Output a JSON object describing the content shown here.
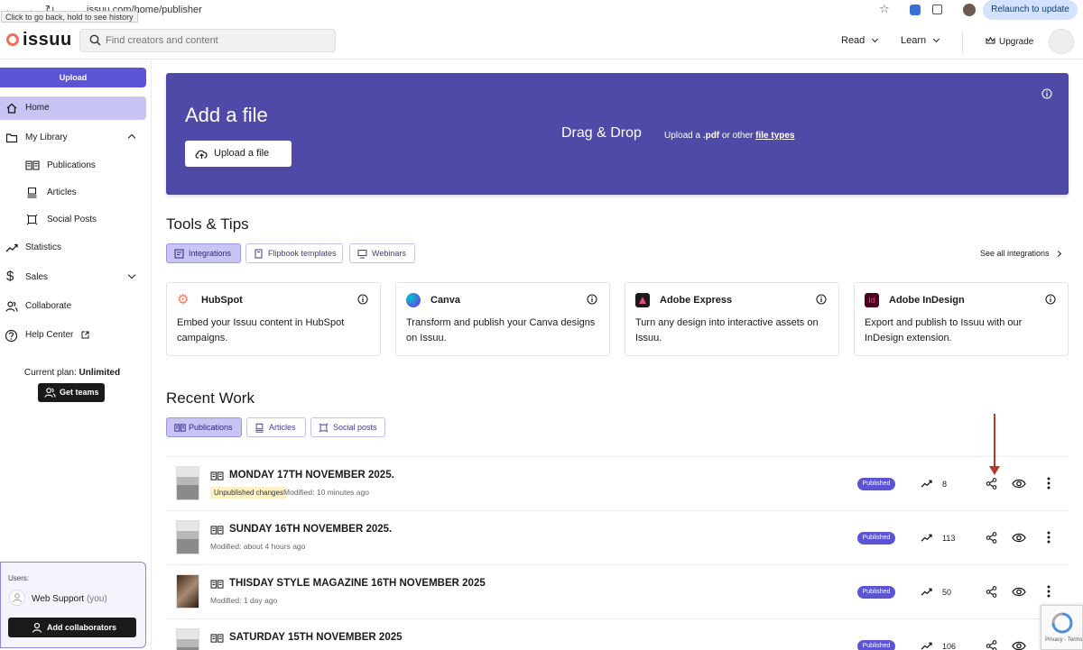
{
  "browser": {
    "url": "issuu.com/home/publisher",
    "tooltip": "Click to go back, hold to see history",
    "relaunch_label": "Relaunch to update"
  },
  "header": {
    "logo": "issuu",
    "search_placeholder": "Find creators and content",
    "read_label": "Read",
    "learn_label": "Learn",
    "upgrade_label": "Upgrade"
  },
  "sidebar": {
    "upload_label": "Upload",
    "items": [
      {
        "label": "Home",
        "icon": "home-icon"
      },
      {
        "label": "My Library",
        "icon": "folder-icon"
      },
      {
        "label": "Publications",
        "icon": "book-icon"
      },
      {
        "label": "Articles",
        "icon": "article-icon"
      },
      {
        "label": "Social Posts",
        "icon": "frame-icon"
      },
      {
        "label": "Statistics",
        "icon": "trend-icon"
      },
      {
        "label": "Sales",
        "icon": "dollar-icon"
      },
      {
        "label": "Collaborate",
        "icon": "people-icon"
      },
      {
        "label": "Help Center",
        "icon": "help-icon"
      }
    ],
    "plan_prefix": "Current plan:",
    "plan_name": "Unlimited",
    "get_teams_label": "Get teams",
    "users_label": "Users:",
    "user_name": "Web Support",
    "user_you": "(you)",
    "add_collaborators_label": "Add collaborators"
  },
  "banner": {
    "title": "Add a file",
    "upload_button": "Upload a file",
    "drag_drop": "Drag & Drop",
    "upload_a": "Upload a",
    "pdf": ".pdf",
    "or_other": "or other",
    "file_types": "file types"
  },
  "tools": {
    "title": "Tools & Tips",
    "chips": [
      "Integrations",
      "Flipbook templates",
      "Webinars"
    ],
    "see_all": "See all integrations",
    "cards": [
      {
        "name": "HubSpot",
        "desc": "Embed your Issuu content in HubSpot campaigns.",
        "color": "#ff7a59"
      },
      {
        "name": "Canva",
        "desc": "Transform and publish your Canva designs on Issuu.",
        "color": "#7d2ae8"
      },
      {
        "name": "Adobe Express",
        "desc": "Turn any design into interactive assets on Issuu.",
        "color": "#1a1a1a"
      },
      {
        "name": "Adobe InDesign",
        "desc": "Export and publish to Issuu with our InDesign extension.",
        "color": "#49021f"
      }
    ]
  },
  "recent": {
    "title": "Recent Work",
    "chips": [
      "Publications",
      "Articles",
      "Social posts"
    ],
    "rows": [
      {
        "title": "MONDAY 17TH NOVEMBER 2025.",
        "badge": "Unpublished changes",
        "modified": "Modified: 10 minutes ago",
        "status": "Published",
        "count": "8"
      },
      {
        "title": "SUNDAY 16TH NOVEMBER 2025.",
        "badge": "",
        "modified": "Modified: about 4 hours ago",
        "status": "Published",
        "count": "113"
      },
      {
        "title": "THISDAY STYLE MAGAZINE 16TH NOVEMBER 2025",
        "badge": "",
        "modified": "Modified: 1 day ago",
        "status": "Published",
        "count": "50"
      },
      {
        "title": "SATURDAY 15TH NOVEMBER 2025",
        "badge": "",
        "modified": "",
        "status": "Published",
        "count": "106"
      }
    ]
  },
  "recaptcha": {
    "text": "Privacy - Terms"
  },
  "colors": {
    "accent": "#5b55d6",
    "banner": "#4f4aa8",
    "chip_active": "#c8c4f4",
    "annotation_arrow": "#b33a2a"
  }
}
